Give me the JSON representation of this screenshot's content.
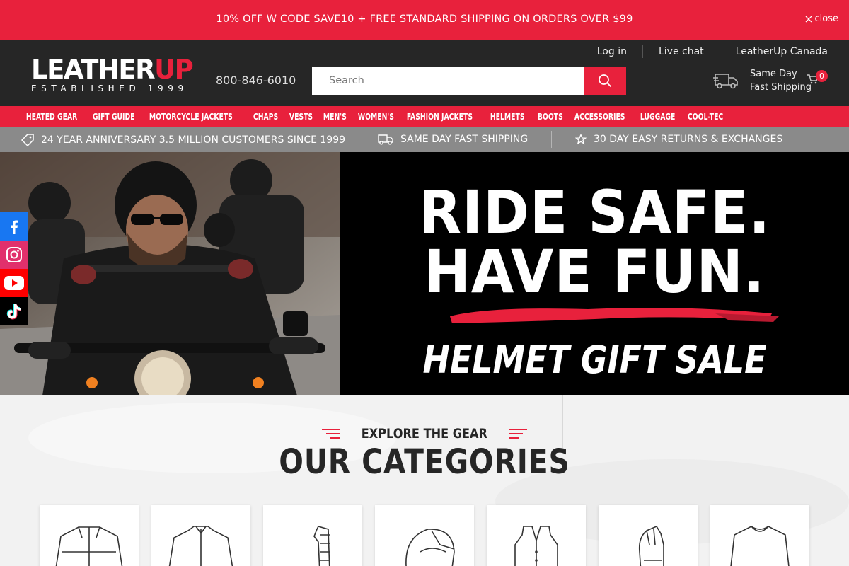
{
  "promo": {
    "text": "10% OFF W CODE SAVE10 + FREE STANDARD SHIPPING ON ORDERS OVER $99",
    "close_label": "close"
  },
  "header": {
    "logo_word_left": "LEATHER",
    "logo_word_right": "UP",
    "logo_tagline": "ESTABLISHED 1999",
    "phone": "800-846-6010",
    "links": [
      "Log in",
      "Live chat",
      "LeatherUp Canada"
    ],
    "search_placeholder": "Search",
    "shipping_line1": "Same Day",
    "shipping_line2": "Fast Shipping",
    "cart_count": "0"
  },
  "nav": {
    "items": [
      "HEATED GEAR",
      "GIFT GUIDE",
      "MOTORCYCLE JACKETS",
      "CHAPS",
      "VESTS",
      "MEN'S",
      "WOMEN'S",
      "FASHION JACKETS",
      "HELMETS",
      "BOOTS",
      "ACCESSORIES",
      "LUGGAGE",
      "COOL-TEC"
    ]
  },
  "info_bar": {
    "items": [
      {
        "icon": "tag-icon",
        "text": "24 YEAR ANNIVERSARY 3.5 MILLION CUSTOMERS SINCE 1999"
      },
      {
        "icon": "truck-icon",
        "text": "SAME DAY FAST SHIPPING"
      },
      {
        "icon": "star-icon",
        "text": "30 DAY EASY RETURNS & EXCHANGES"
      }
    ]
  },
  "hero": {
    "line1": "RIDE SAFE.",
    "line2": "HAVE FUN.",
    "line3": "HELMET GIFT SALE",
    "accent_color": "#e8213c"
  },
  "social": [
    "facebook-icon",
    "instagram-icon",
    "youtube-icon",
    "tiktok-icon"
  ],
  "categories": {
    "eyebrow": "EXPLORE THE GEAR",
    "title": "OUR CATEGORIES",
    "cards": [
      "jacket-icon",
      "shirt-icon",
      "chaps-icon",
      "helmet-icon",
      "vest-icon",
      "glove-icon",
      "sweater-icon"
    ]
  },
  "colors": {
    "brand_red": "#e8213c",
    "header_dark": "#262626",
    "info_gray": "#8a8a8a"
  }
}
